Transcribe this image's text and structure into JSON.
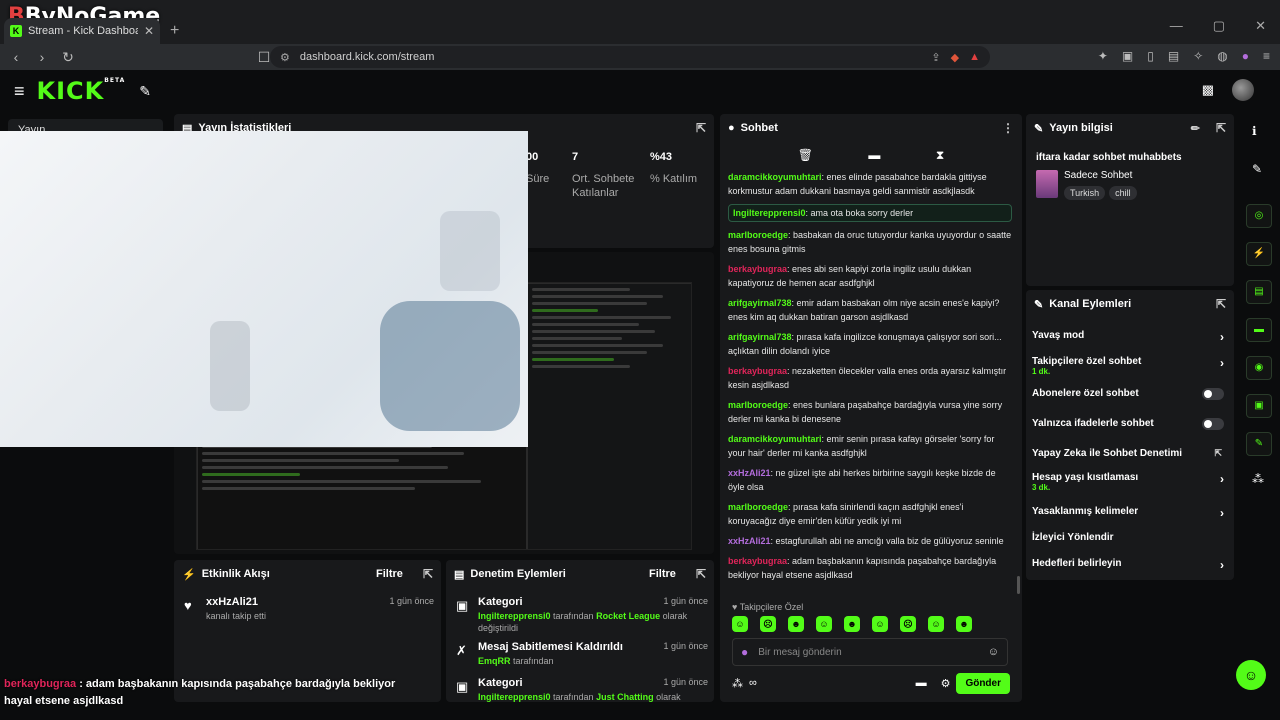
{
  "browser": {
    "watermark": "ByNoGame",
    "tab_title": "Stream - Kick Dashboard",
    "url": "dashboard.kick.com/stream"
  },
  "app": {
    "logo": "KICK",
    "logo_badge": "BETA",
    "left_nav_label": "Yayın"
  },
  "stats": {
    "title": "Yayın İstatistikleri",
    "items": [
      {
        "value": "00",
        "label": "Süre"
      },
      {
        "value": "7",
        "label": "Ort. Sohbete Katılanlar"
      },
      {
        "value": "%43",
        "label": "% Katılım"
      }
    ]
  },
  "activity": {
    "title": "Etkinlik Akışı",
    "filter": "Filtre",
    "items": [
      {
        "name": "xxHzAli21",
        "sub": "kanalı takip etti",
        "time": "1 gün önce"
      }
    ]
  },
  "moderation": {
    "title": "Denetim Eylemleri",
    "filter": "Filtre",
    "items": [
      {
        "title": "Kategori",
        "actor": "Ingilterepprensi0",
        "mid": " tarafından ",
        "target": "Rocket League",
        "rest": " olarak değiştirildi",
        "time": "1 gün önce"
      },
      {
        "title": "Mesaj Sabitlemesi Kaldırıldı",
        "actor": "EmqRR",
        "mid": " tarafından",
        "target": "",
        "rest": "",
        "time": "1 gün önce"
      },
      {
        "title": "Kategori",
        "actor": "Ingilterepprensi0",
        "mid": " tarafından ",
        "target": "Just Chatting",
        "rest": " olarak değiştirildi",
        "time": "1 gün önce"
      }
    ]
  },
  "caption": {
    "user": "berkaybugraa",
    "text": " : adam başbakanın kapısında paşabahçe bardağıyla bekliyor hayal etsene asjdlkasd"
  },
  "chat": {
    "title": "Sohbet",
    "messages": [
      {
        "user": "daramcikkoyumuhtari",
        "color": "#53fc18",
        "text": ": enes elinde pasabahce bardakla gittiyse korkmustur adam dukkani basmaya geldi sanmistir asdkjlasdk"
      },
      {
        "user": "Ingilterepprensi0",
        "color": "#53fc18",
        "text": ": ama ota boka sorry derler",
        "highlight": true
      },
      {
        "user": "marlboroedge",
        "color": "#53fc18",
        "text": ": basbakan da oruc tutuyordur kanka uyuyordur o saatte enes bosuna gitmis"
      },
      {
        "user": "berkaybugraa",
        "color": "#e0255a",
        "text": ": enes abi sen kapiyi zorla ingiliz usulu dukkan kapatiyoruz de hemen acar asdfghjkl"
      },
      {
        "user": "arifgayirnal738",
        "color": "#53fc18",
        "text": ": emir adam basbakan olm niye acsin enes'e kapiyi? enes kim aq dukkan batiran garson asjdlkasd"
      },
      {
        "user": "arifgayirnal738",
        "color": "#53fc18",
        "text": ": pırasa kafa ingilizce konuşmaya çalışıyor sori sori... açlıktan dilin dolandı iyice"
      },
      {
        "user": "berkaybugraa",
        "color": "#e0255a",
        "text": ": nezaketten ölecekler valla enes orda ayarsız kalmıştır kesin asjdlkasd"
      },
      {
        "user": "marlboroedge",
        "color": "#53fc18",
        "text": ": enes bunlara paşabahçe bardağıyla vursa yine sorry derler mi kanka bi denesene"
      },
      {
        "user": "daramcikkoyumuhtari",
        "color": "#53fc18",
        "text": ": emir senin pırasa kafayı görseler 'sorry for your hair' derler mi kanka asdfghjkl"
      },
      {
        "user": "xxHzAli21",
        "color": "#b36ddc",
        "text": ": ne güzel işte abi herkes birbirine saygılı keşke bizde de öyle olsa"
      },
      {
        "user": "marlboroedge",
        "color": "#53fc18",
        "text": ": pırasa kafa sinirlendi kaçın asdfghjkl enes'i koruyacağız diye emir'den küfür yedik iyi mi"
      },
      {
        "user": "xxHzAli21",
        "color": "#b36ddc",
        "text": ": estagfurullah abi ne amcığı valla biz de gülüyoruz seninle"
      },
      {
        "user": "berkaybugraa",
        "color": "#e0255a",
        "text": ": adam başbakanın kapısında paşabahçe bardağıyla bekliyor hayal etsene asjdlkasd"
      }
    ],
    "followers_label": "Takipçilere Özel",
    "input_placeholder": "Bir mesaj gönderin",
    "send_label": "Gönder"
  },
  "stream_info": {
    "title": "Yayın bilgisi",
    "stream_title": "iftara kadar sohbet muhabbets",
    "category": "Sadece Sohbet",
    "tags": [
      "Turkish",
      "chill"
    ]
  },
  "channel_actions": {
    "title": "Kanal Eylemleri",
    "items": [
      {
        "label": "Yavaş mod",
        "sub": "",
        "control": "chevron"
      },
      {
        "label": "Takipçilere özel sohbet",
        "sub": "1 dk.",
        "control": "chevron"
      },
      {
        "label": "Abonelere özel sohbet",
        "sub": "",
        "control": "toggle"
      },
      {
        "label": "Yalnızca ifadelerle sohbet",
        "sub": "",
        "control": "toggle"
      },
      {
        "label": "Yapay Zeka ile Sohbet Denetimi",
        "sub": "",
        "control": "external"
      },
      {
        "label": "Hesap yaşı kısıtlaması",
        "sub": "3 dk.",
        "control": "chevron"
      },
      {
        "label": "Yasaklanmış kelimeler",
        "sub": "",
        "control": "chevron"
      },
      {
        "label": "İzleyici Yönlendir",
        "sub": "",
        "control": "none"
      },
      {
        "label": "Hedefleri belirleyin",
        "sub": "",
        "control": "chevron"
      }
    ]
  }
}
